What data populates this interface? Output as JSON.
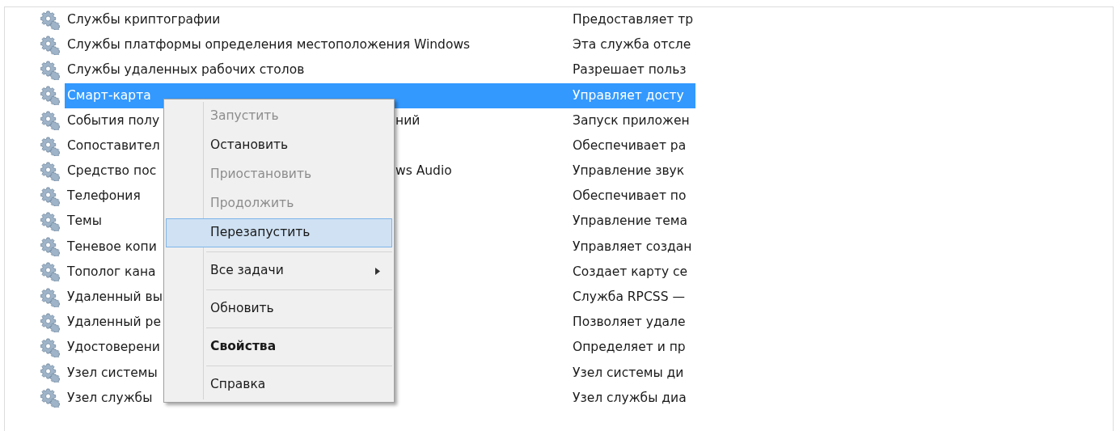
{
  "services": [
    {
      "name": "Службы криптографии",
      "description": "Предоставляет тр",
      "selected": false
    },
    {
      "name": "Службы платформы определения местоположения Windows",
      "description": "Эта служба отсле",
      "selected": false
    },
    {
      "name": "Службы удаленных рабочих столов",
      "description": "Разрешает польз",
      "selected": false
    },
    {
      "name": "Смарт-карта",
      "description": "Управляет досту",
      "selected": true
    },
    {
      "name": "События полу",
      "name_tail": "ний",
      "description": "Запуск приложен",
      "selected": false
    },
    {
      "name": "Сопоставител",
      "description": "Обеспечивает ра",
      "selected": false
    },
    {
      "name": "Средство пос",
      "name_tail": "ws Audio",
      "description": "Управление звук",
      "selected": false
    },
    {
      "name": "Телефония",
      "description": "Обеспечивает по",
      "selected": false
    },
    {
      "name": "Темы",
      "description": "Управление тема",
      "selected": false
    },
    {
      "name": "Теневое копи",
      "description": "Управляет создан",
      "selected": false
    },
    {
      "name": "Тополог кана",
      "description": "Создает карту се",
      "selected": false
    },
    {
      "name": "Удаленный вы",
      "description": "Служба RPCSS —",
      "selected": false
    },
    {
      "name": "Удаленный ре",
      "description": "Позволяет удале",
      "selected": false
    },
    {
      "name": "Удостоверени",
      "description": "Определяет и пр",
      "selected": false
    },
    {
      "name": "Узел системы",
      "description": "Узел системы ди",
      "selected": false
    },
    {
      "name": "Узел службы",
      "description": "Узел службы диа",
      "selected": false
    }
  ],
  "context_menu": [
    {
      "kind": "item",
      "label": "Запустить",
      "disabled": true,
      "selected": false
    },
    {
      "kind": "item",
      "label": "Остановить",
      "disabled": false,
      "selected": false
    },
    {
      "kind": "item",
      "label": "Приостановить",
      "disabled": true,
      "selected": false
    },
    {
      "kind": "item",
      "label": "Продолжить",
      "disabled": true,
      "selected": false
    },
    {
      "kind": "item",
      "label": "Перезапустить",
      "disabled": false,
      "selected": true
    },
    {
      "kind": "separator"
    },
    {
      "kind": "submenu",
      "label": "Все задачи",
      "disabled": false,
      "selected": false
    },
    {
      "kind": "separator"
    },
    {
      "kind": "item",
      "label": "Обновить",
      "disabled": false,
      "selected": false
    },
    {
      "kind": "separator"
    },
    {
      "kind": "default",
      "label": "Свойства",
      "disabled": false,
      "selected": false
    },
    {
      "kind": "separator"
    },
    {
      "kind": "item",
      "label": "Справка",
      "disabled": false,
      "selected": false
    }
  ]
}
